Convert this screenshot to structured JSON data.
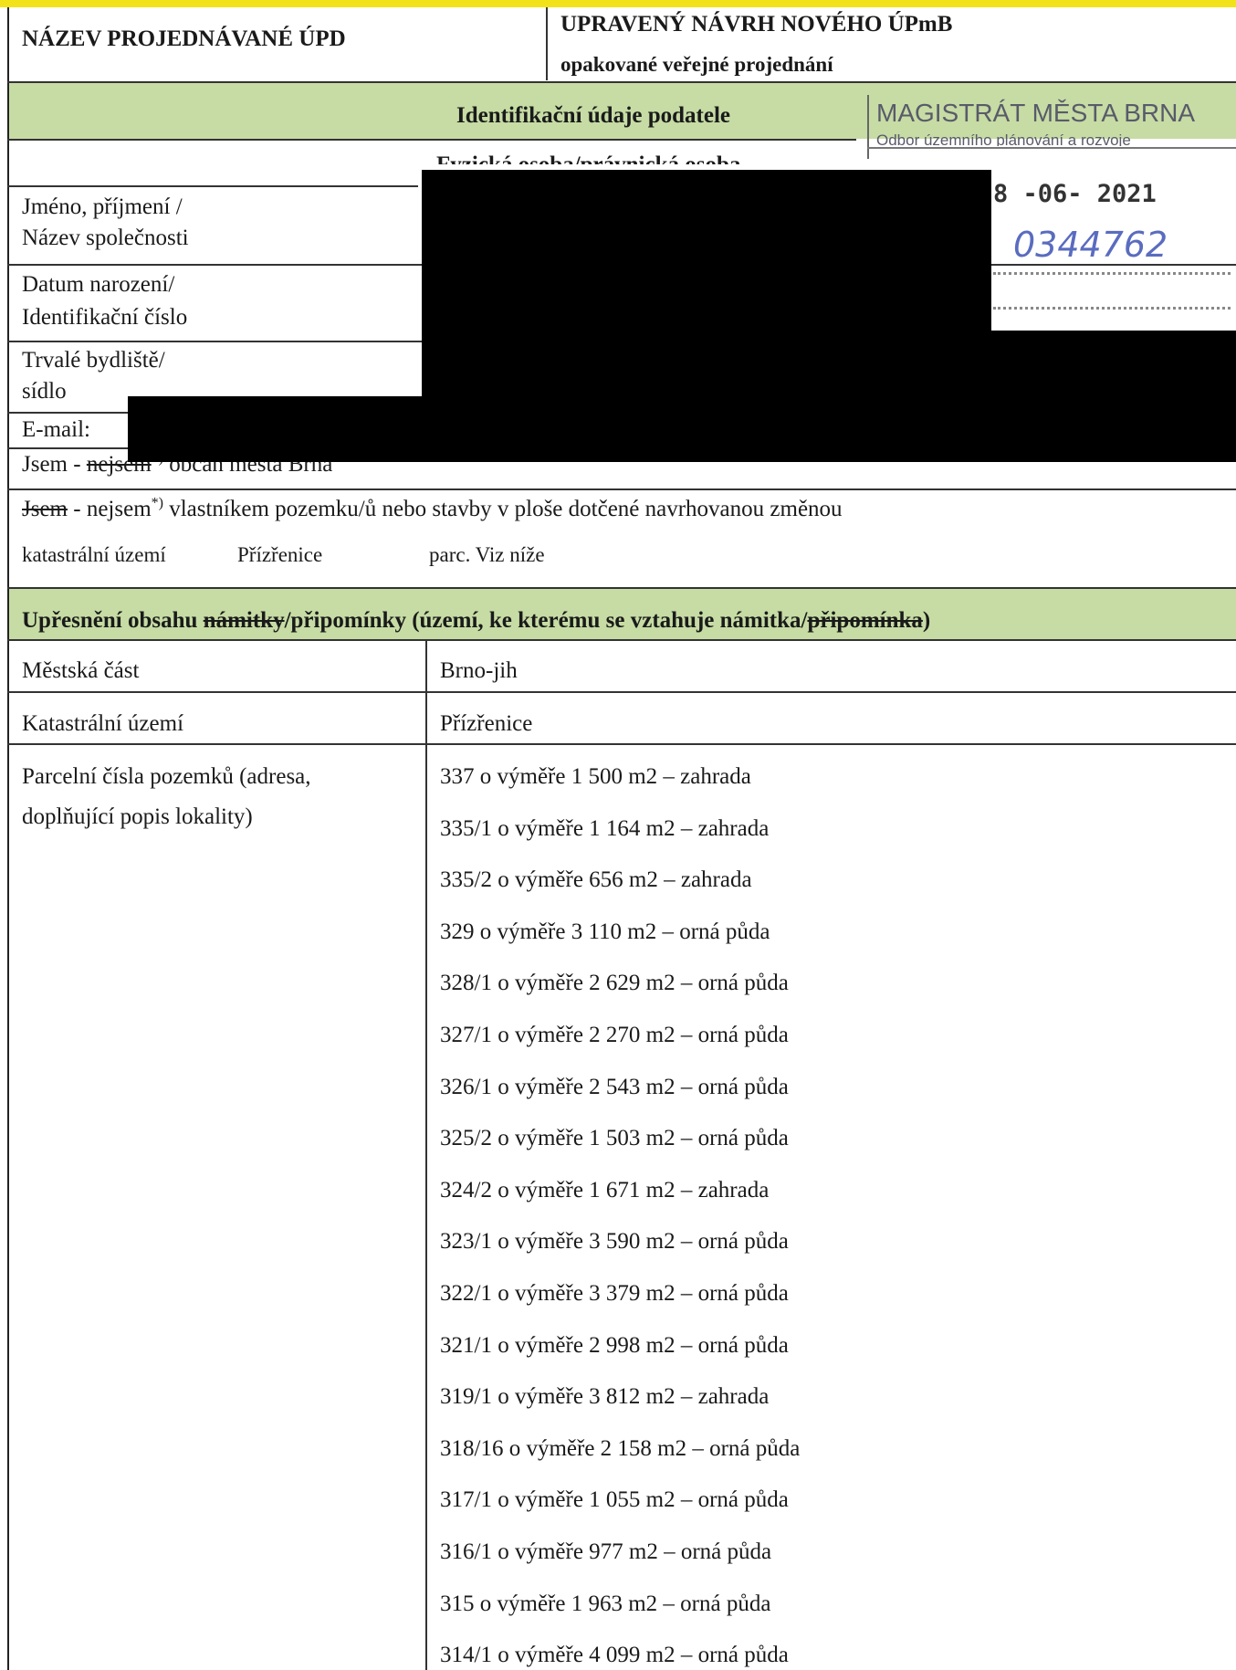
{
  "header": {
    "left_title": "NÁZEV PROJEDNÁVANÉ ÚPD",
    "right_title": "UPRAVENÝ NÁVRH NOVÉHO ÚPmB",
    "right_subtitle": "opakované veřejné projednání"
  },
  "identification": {
    "section_title": "Identifikační údaje podatele",
    "subsection_title": "Fyzická osoba/právnická osoba",
    "fields": [
      {
        "label_line1": "Jméno, příjmení /",
        "label_line2": "Název společnosti"
      },
      {
        "label_line1": "Datum narození/",
        "label_line2": "Identifikační číslo"
      },
      {
        "label_line1": "Trvalé bydliště/",
        "label_line2": "sídlo"
      }
    ],
    "email_label": "E-mail:",
    "citizen_prefix": "Jsem - ",
    "citizen_struck": "nejsem",
    "citizen_mark": "*)",
    "citizen_rest": " občan města Brna",
    "owner_struck": "Jsem",
    "owner_mid": " - nejsem",
    "owner_mark": "*)",
    "owner_rest": " vlastníkem pozemku/ů nebo stavby v ploše dotčené navrhovanou změnou",
    "cadastral_label": "katastrální území",
    "cadastral_value": "Přízřenice",
    "parcel_label": "parc. Viz níže"
  },
  "stamp": {
    "office": "MAGISTRÁT MĚSTA BRNA",
    "department": "Odbor územního plánování a rozvoje",
    "date": "8 -06- 2021",
    "number": "0344762"
  },
  "specification": {
    "title_part1": "Upřesnění obsahu ",
    "title_struck1": "námitky",
    "title_part2": "/připomínky (území, ke kterému se vztahuje námitka/",
    "title_struck2": "připomínka",
    "title_part3": ")",
    "district_label": "Městská část",
    "district_value": "Brno-jih",
    "cadastre_label": "Katastrální území",
    "cadastre_value": "Přízřenice",
    "parcels_label_line1": "Parcelní čísla pozemků (adresa,",
    "parcels_label_line2": "doplňující popis lokality)",
    "parcels": [
      "337 o výměře 1 500 m2 – zahrada",
      "335/1 o výměře 1 164 m2 – zahrada",
      "335/2 o výměře 656 m2 – zahrada",
      "329 o výměře 3 110 m2 – orná půda",
      "328/1 o výměře 2 629 m2 – orná půda",
      "327/1 o výměře 2 270 m2 – orná půda",
      "326/1 o výměře 2 543 m2 – orná půda",
      "325/2 o výměře 1 503 m2 – orná půda",
      "324/2 o výměře 1 671 m2 – zahrada",
      "323/1 o výměře 3 590 m2 – orná půda",
      "322/1 o výměře 3 379 m2 – orná půda",
      "321/1 o výměře 2 998 m2 – orná půda",
      "319/1 o výměře 3 812 m2 – zahrada",
      "318/16 o výměře 2 158 m2 – orná půda",
      "317/1 o výměře 1 055 m2 – orná půda",
      "316/1 o výměře 977 m2 – orná půda",
      "315 o výměře 1 963 m2 – orná půda",
      "314/1 o výměře 4 099 m2 – orná půda"
    ]
  },
  "colors": {
    "yellow_bar": "#f2e21a",
    "section_green": "#c6dca4",
    "stamp_ink": "#5a6cbf"
  }
}
